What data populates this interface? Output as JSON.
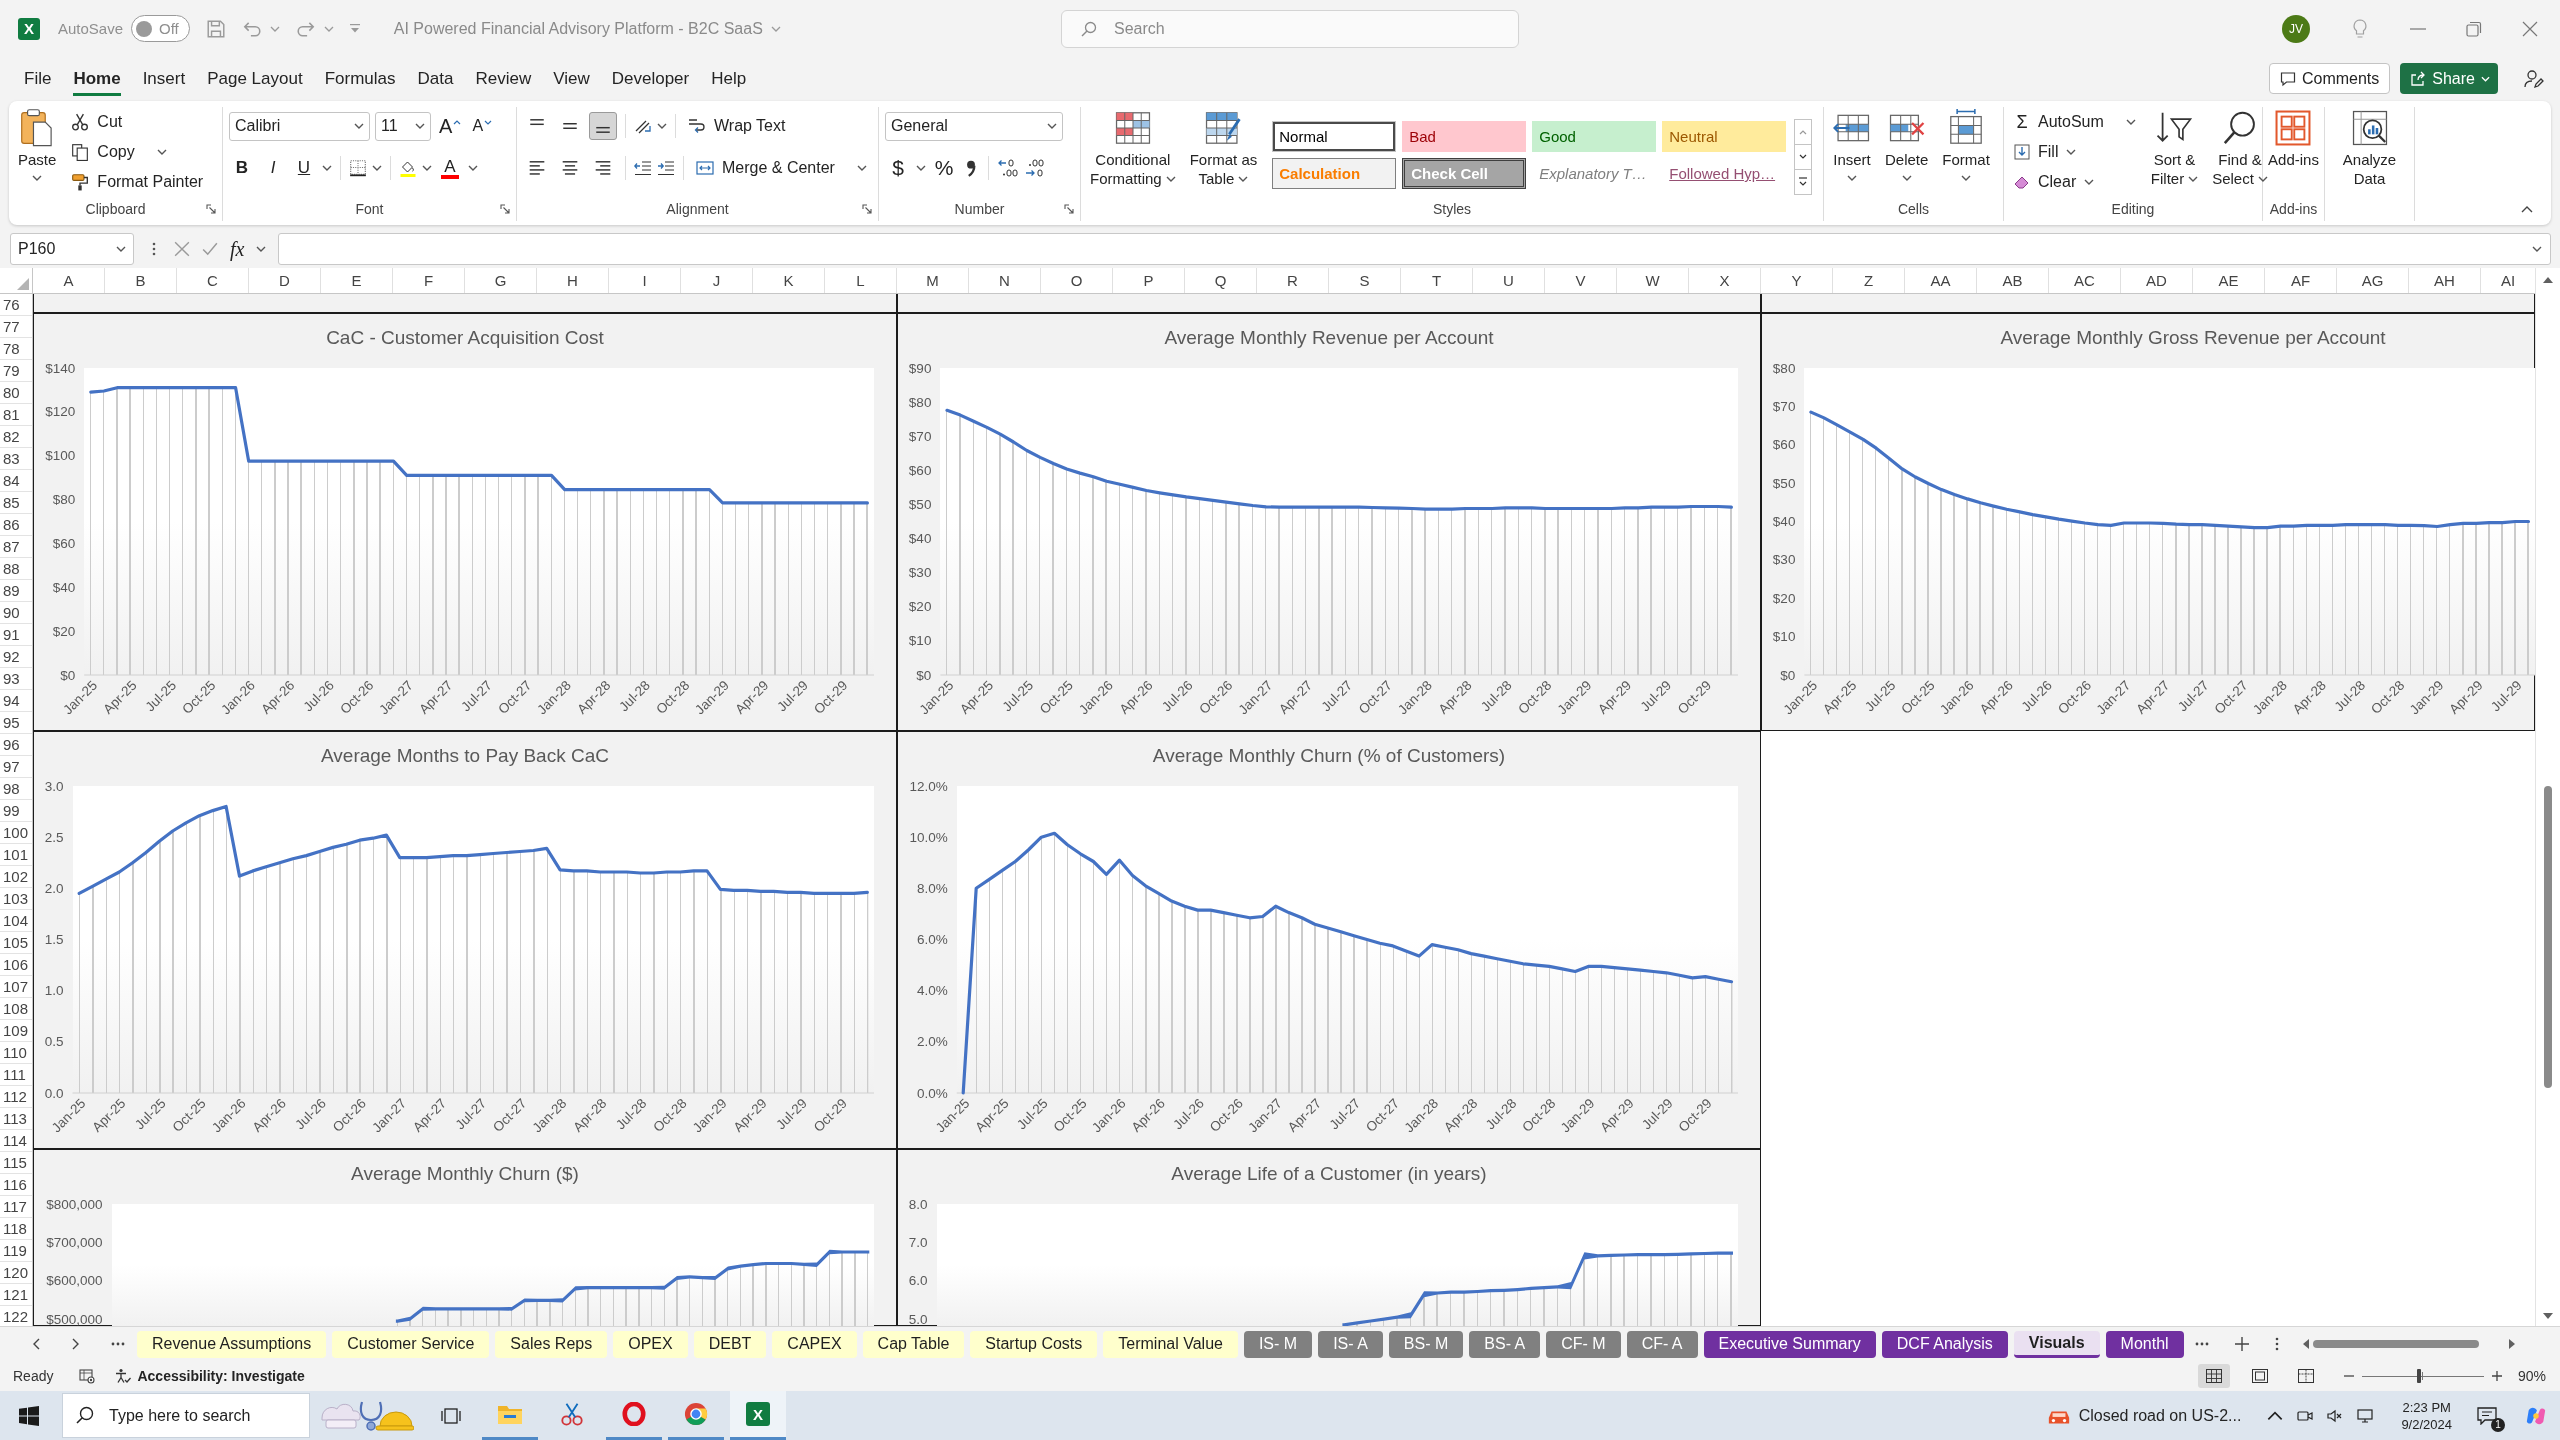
{
  "title_bar": {
    "app_icon": "X",
    "autosave": {
      "label": "AutoSave",
      "state_label": "Off",
      "on": false
    },
    "document_title": "AI Powered Financial Advisory Platform - B2C SaaS",
    "search": {
      "placeholder": "Search"
    },
    "avatar": "JV"
  },
  "menu": {
    "tabs": [
      {
        "label": "File",
        "selected": false
      },
      {
        "label": "Home",
        "selected": true
      },
      {
        "label": "Insert",
        "selected": false
      },
      {
        "label": "Page Layout",
        "selected": false
      },
      {
        "label": "Formulas",
        "selected": false
      },
      {
        "label": "Data",
        "selected": false
      },
      {
        "label": "Review",
        "selected": false
      },
      {
        "label": "View",
        "selected": false
      },
      {
        "label": "Developer",
        "selected": false
      },
      {
        "label": "Help",
        "selected": false
      }
    ],
    "comments": "Comments",
    "share": "Share"
  },
  "ribbon": {
    "clipboard": {
      "label": "Clipboard",
      "paste": "Paste",
      "cut": "Cut",
      "copy": "Copy",
      "format_painter": "Format Painter"
    },
    "font": {
      "label": "Font",
      "font_name": "Calibri",
      "font_size": "11",
      "grow": "A",
      "shrink": "A",
      "bold": "B",
      "italic": "I",
      "underline": "U",
      "font_color": "A"
    },
    "alignment": {
      "label": "Alignment",
      "vertical": [
        {
          "kind": "top",
          "selected": false
        },
        {
          "kind": "middle",
          "selected": false
        },
        {
          "kind": "bottom",
          "selected": true
        }
      ],
      "horizontal": [
        {
          "kind": "left",
          "selected": false
        },
        {
          "kind": "center",
          "selected": false
        },
        {
          "kind": "right",
          "selected": false
        }
      ],
      "wrap_text": "Wrap Text",
      "merge_center": "Merge & Center"
    },
    "number": {
      "label": "Number",
      "format": "General",
      "currency": "$",
      "percent": "%"
    },
    "styles": {
      "label": "Styles",
      "conditional_formatting": [
        "Conditional",
        "Formatting"
      ],
      "format_as_table": [
        "Format as",
        "Table"
      ],
      "gallery": [
        {
          "label": "Normal",
          "kind": "normal",
          "selected": true
        },
        {
          "label": "Bad",
          "kind": "bad",
          "selected": false
        },
        {
          "label": "Good",
          "kind": "good",
          "selected": false
        },
        {
          "label": "Neutral",
          "kind": "neutral",
          "selected": false
        },
        {
          "label": "Calculation",
          "kind": "calculation",
          "selected": false
        },
        {
          "label": "Check Cell",
          "kind": "check",
          "selected": false
        },
        {
          "label": "Explanatory T…",
          "kind": "explanatory",
          "selected": false
        },
        {
          "label": "Followed Hyp…",
          "kind": "followed_link",
          "selected": false
        }
      ]
    },
    "cells": {
      "label": "Cells",
      "buttons": [
        {
          "kind": "insert",
          "label": "Insert"
        },
        {
          "kind": "delete",
          "label": "Delete"
        },
        {
          "kind": "format",
          "label": "Format"
        }
      ]
    },
    "editing": {
      "label": "Editing",
      "autosum_symbol": "Σ",
      "autosum": "AutoSum",
      "fill": "Fill",
      "clear": "Clear",
      "sort_filter": [
        "Sort &",
        "Filter"
      ],
      "find_select": [
        "Find &",
        "Select"
      ]
    },
    "add_ins": {
      "label": "Add-ins",
      "button": "Add-ins"
    },
    "analyze": {
      "button": [
        "Analyze",
        "Data"
      ]
    }
  },
  "formula_bar": {
    "name_box": "P160",
    "fx": "fx"
  },
  "sheet": {
    "columns": [
      "A",
      "B",
      "C",
      "D",
      "E",
      "F",
      "G",
      "H",
      "I",
      "J",
      "K",
      "L",
      "M",
      "N",
      "O",
      "P",
      "Q",
      "R",
      "S",
      "T",
      "U",
      "V",
      "W",
      "X",
      "Y",
      "Z",
      "AA",
      "AB",
      "AC",
      "AD",
      "AE",
      "AF",
      "AG",
      "AH",
      "AI"
    ],
    "rows": [
      "76",
      "77",
      "78",
      "79",
      "80",
      "81",
      "82",
      "83",
      "84",
      "85",
      "86",
      "87",
      "88",
      "89",
      "90",
      "91",
      "92",
      "93",
      "94",
      "95",
      "96",
      "97",
      "98",
      "99",
      "100",
      "101",
      "102",
      "103",
      "104",
      "105",
      "106",
      "107",
      "108",
      "109",
      "110",
      "111",
      "112",
      "113",
      "114",
      "115",
      "116",
      "117",
      "118",
      "119",
      "120",
      "121",
      "122"
    ],
    "chart_rows": [
      [
        {
          "kind": "data_chart",
          "chart_data": {
            "type": "line",
            "title": "CaC - Customer Acquisition Cost",
            "ylim": [
              0,
              140
            ],
            "yticks": [
              {
                "value": 0,
                "label": "$0"
              },
              {
                "value": 20,
                "label": "$20"
              },
              {
                "value": 40,
                "label": "$40"
              },
              {
                "value": 60,
                "label": "$60"
              },
              {
                "value": 80,
                "label": "$80"
              },
              {
                "value": 100,
                "label": "$100"
              },
              {
                "value": 120,
                "label": "$120"
              },
              {
                "value": 140,
                "label": "$140"
              }
            ],
            "categories": [
              "Jan-25",
              null,
              null,
              "Apr-25",
              null,
              null,
              "Jul-25",
              null,
              null,
              "Oct-25",
              null,
              null,
              "Jan-26",
              null,
              null,
              "Apr-26",
              null,
              null,
              "Jul-26",
              null,
              null,
              "Oct-26",
              null,
              null,
              "Jan-27",
              null,
              null,
              "Apr-27",
              null,
              null,
              "Jul-27",
              null,
              null,
              "Oct-27",
              null,
              null,
              "Jan-28",
              null,
              null,
              "Apr-28",
              null,
              null,
              "Jul-28",
              null,
              null,
              "Oct-28",
              null,
              null,
              "Jan-29",
              null,
              null,
              "Apr-29",
              null,
              null,
              "Jul-29",
              null,
              null,
              "Oct-29",
              null,
              null
            ],
            "values": [
              129,
              129.5,
              131,
              131,
              131,
              131,
              131,
              131,
              131,
              131,
              131,
              131,
              97.5,
              97.5,
              97.5,
              97.5,
              97.5,
              97.5,
              97.5,
              97.5,
              97.5,
              97.5,
              97.5,
              97.5,
              91,
              91,
              91,
              91,
              91,
              91,
              91,
              91,
              91,
              91,
              91,
              91,
              84.5,
              84.5,
              84.5,
              84.5,
              84.5,
              84.5,
              84.5,
              84.5,
              84.5,
              84.5,
              84.5,
              84.5,
              78.5,
              78.5,
              78.5,
              78.5,
              78.5,
              78.5,
              78.5,
              78.5,
              78.5,
              78.5,
              78.5,
              78.5
            ]
          }
        },
        {
          "kind": "data_chart",
          "chart_data": {
            "type": "line",
            "title": "Average Monthly Revenue per Account",
            "ylim": [
              0,
              90
            ],
            "yticks": [
              {
                "value": 0,
                "label": "$0"
              },
              {
                "value": 10,
                "label": "$10"
              },
              {
                "value": 20,
                "label": "$20"
              },
              {
                "value": 30,
                "label": "$30"
              },
              {
                "value": 40,
                "label": "$40"
              },
              {
                "value": 50,
                "label": "$50"
              },
              {
                "value": 60,
                "label": "$60"
              },
              {
                "value": 70,
                "label": "$70"
              },
              {
                "value": 80,
                "label": "$80"
              },
              {
                "value": 90,
                "label": "$90"
              }
            ],
            "categories": [
              "Jan-25",
              null,
              null,
              "Apr-25",
              null,
              null,
              "Jul-25",
              null,
              null,
              "Oct-25",
              null,
              null,
              "Jan-26",
              null,
              null,
              "Apr-26",
              null,
              null,
              "Jul-26",
              null,
              null,
              "Oct-26",
              null,
              null,
              "Jan-27",
              null,
              null,
              "Apr-27",
              null,
              null,
              "Jul-27",
              null,
              null,
              "Oct-27",
              null,
              null,
              "Jan-28",
              null,
              null,
              "Apr-28",
              null,
              null,
              "Jul-28",
              null,
              null,
              "Oct-28",
              null,
              null,
              "Jan-29",
              null,
              null,
              "Apr-29",
              null,
              null,
              "Jul-29",
              null,
              null,
              "Oct-29",
              null,
              null
            ],
            "values": [
              77.6,
              76.2,
              74.4,
              72.6,
              70.6,
              68.3,
              65.8,
              63.8,
              62.0,
              60.4,
              59.2,
              58.1,
              56.8,
              55.9,
              55.0,
              54.1,
              53.4,
              52.8,
              52.2,
              51.7,
              51.2,
              50.7,
              50.2,
              49.7,
              49.3,
              49.2,
              49.2,
              49.2,
              49.2,
              49.2,
              49.2,
              49.2,
              49.1,
              49.0,
              48.9,
              48.8,
              48.6,
              48.6,
              48.6,
              48.8,
              48.8,
              48.8,
              49.0,
              49.0,
              49.0,
              48.8,
              48.8,
              48.8,
              48.8,
              48.8,
              48.8,
              49.0,
              49.0,
              49.2,
              49.2,
              49.2,
              49.4,
              49.4,
              49.4,
              49.2
            ]
          }
        },
        {
          "kind": "data_chart",
          "chart_data": {
            "type": "line",
            "title": "Average Monthly Gross Revenue per Account",
            "ylim": [
              0,
              80
            ],
            "yticks": [
              {
                "value": 0,
                "label": "$0"
              },
              {
                "value": 10,
                "label": "$10"
              },
              {
                "value": 20,
                "label": "$20"
              },
              {
                "value": 30,
                "label": "$30"
              },
              {
                "value": 40,
                "label": "$40"
              },
              {
                "value": 50,
                "label": "$50"
              },
              {
                "value": 60,
                "label": "$60"
              },
              {
                "value": 70,
                "label": "$70"
              },
              {
                "value": 80,
                "label": "$80"
              }
            ],
            "categories": [
              "Jan-25",
              null,
              null,
              "Apr-25",
              null,
              null,
              "Jul-25",
              null,
              null,
              "Oct-25",
              null,
              null,
              "Jan-26",
              null,
              null,
              "Apr-26",
              null,
              null,
              "Jul-26",
              null,
              null,
              "Oct-26",
              null,
              null,
              "Jan-27",
              null,
              null,
              "Apr-27",
              null,
              null,
              "Jul-27",
              null,
              null,
              "Oct-27",
              null,
              null,
              "Jan-28",
              null,
              null,
              "Apr-28",
              null,
              null,
              "Jul-28",
              null,
              null,
              "Oct-28",
              null,
              null,
              "Jan-29",
              null,
              null,
              "Apr-29",
              null,
              null,
              "Jul-29",
              null
            ],
            "values": [
              68.5,
              67.0,
              65.2,
              63.3,
              61.4,
              59.1,
              56.4,
              53.7,
              51.6,
              49.9,
              48.3,
              47.0,
              45.9,
              44.9,
              44.0,
              43.2,
              42.5,
              41.8,
              41.2,
              40.6,
              40.1,
              39.6,
              39.2,
              39.0,
              39.6,
              39.6,
              39.6,
              39.5,
              39.3,
              39.2,
              39.2,
              39.0,
              38.8,
              38.6,
              38.4,
              38.4,
              38.8,
              38.8,
              39.0,
              39.0,
              39.0,
              39.2,
              39.2,
              39.2,
              39.2,
              39.0,
              39.0,
              38.9,
              38.7,
              39.2,
              39.5,
              39.5,
              39.7,
              39.7,
              40.0,
              40.0
            ]
          }
        }
      ],
      [
        {
          "kind": "data_chart",
          "chart_data": {
            "type": "line",
            "title": "Average Months to Pay Back CaC",
            "ylim": [
              0,
              3
            ],
            "yticks": [
              {
                "value": 0,
                "label": "0.0"
              },
              {
                "value": 0.5,
                "label": "0.5"
              },
              {
                "value": 1,
                "label": "1.0"
              },
              {
                "value": 1.5,
                "label": "1.5"
              },
              {
                "value": 2,
                "label": "2.0"
              },
              {
                "value": 2.5,
                "label": "2.5"
              },
              {
                "value": 3,
                "label": "3.0"
              }
            ],
            "categories": [
              "Jan-25",
              null,
              null,
              "Apr-25",
              null,
              null,
              "Jul-25",
              null,
              null,
              "Oct-25",
              null,
              null,
              "Jan-26",
              null,
              null,
              "Apr-26",
              null,
              null,
              "Jul-26",
              null,
              null,
              "Oct-26",
              null,
              null,
              "Jan-27",
              null,
              null,
              "Apr-27",
              null,
              null,
              "Jul-27",
              null,
              null,
              "Oct-27",
              null,
              null,
              "Jan-28",
              null,
              null,
              "Apr-28",
              null,
              null,
              "Jul-28",
              null,
              null,
              "Oct-28",
              null,
              null,
              "Jan-29",
              null,
              null,
              "Apr-29",
              null,
              null,
              "Jul-29",
              null,
              null,
              "Oct-29",
              null,
              null
            ],
            "values": [
              1.95,
              2.02,
              2.09,
              2.16,
              2.25,
              2.35,
              2.46,
              2.56,
              2.64,
              2.71,
              2.76,
              2.8,
              2.12,
              2.17,
              2.21,
              2.25,
              2.29,
              2.32,
              2.36,
              2.4,
              2.43,
              2.47,
              2.49,
              2.52,
              2.3,
              2.3,
              2.3,
              2.31,
              2.32,
              2.32,
              2.33,
              2.34,
              2.35,
              2.36,
              2.37,
              2.39,
              2.18,
              2.17,
              2.17,
              2.16,
              2.16,
              2.16,
              2.15,
              2.15,
              2.16,
              2.16,
              2.17,
              2.17,
              1.99,
              1.98,
              1.98,
              1.97,
              1.97,
              1.96,
              1.96,
              1.95,
              1.95,
              1.95,
              1.95,
              1.96
            ]
          }
        },
        {
          "kind": "data_chart",
          "chart_data": {
            "type": "line",
            "title": "Average Monthly Churn (% of Customers)",
            "ylim": [
              0,
              12
            ],
            "yticks": [
              {
                "value": 0,
                "label": "0.0%"
              },
              {
                "value": 2,
                "label": "2.0%"
              },
              {
                "value": 4,
                "label": "4.0%"
              },
              {
                "value": 6,
                "label": "6.0%"
              },
              {
                "value": 8,
                "label": "8.0%"
              },
              {
                "value": 10,
                "label": "10.0%"
              },
              {
                "value": 12,
                "label": "12.0%"
              }
            ],
            "categories": [
              "Jan-25",
              null,
              null,
              "Apr-25",
              null,
              null,
              "Jul-25",
              null,
              null,
              "Oct-25",
              null,
              null,
              "Jan-26",
              null,
              null,
              "Apr-26",
              null,
              null,
              "Jul-26",
              null,
              null,
              "Oct-26",
              null,
              null,
              "Jan-27",
              null,
              null,
              "Apr-27",
              null,
              null,
              "Jul-27",
              null,
              null,
              "Oct-27",
              null,
              null,
              "Jan-28",
              null,
              null,
              "Apr-28",
              null,
              null,
              "Jul-28",
              null,
              null,
              "Oct-28",
              null,
              null,
              "Jan-29",
              null,
              null,
              "Apr-29",
              null,
              null,
              "Jul-29",
              null,
              null,
              "Oct-29",
              null,
              null
            ],
            "values": [
              0,
              8.0,
              8.35,
              8.7,
              9.05,
              9.5,
              10.0,
              10.15,
              9.7,
              9.35,
              9.05,
              8.55,
              9.1,
              8.5,
              8.1,
              7.8,
              7.5,
              7.3,
              7.15,
              7.15,
              7.05,
              6.95,
              6.85,
              6.9,
              7.3,
              7.05,
              6.85,
              6.6,
              6.45,
              6.3,
              6.15,
              6.0,
              5.85,
              5.75,
              5.55,
              5.35,
              5.8,
              5.7,
              5.6,
              5.45,
              5.35,
              5.25,
              5.15,
              5.05,
              5.0,
              4.95,
              4.85,
              4.75,
              4.95,
              4.95,
              4.9,
              4.85,
              4.8,
              4.75,
              4.7,
              4.6,
              4.5,
              4.55,
              4.45,
              4.35
            ]
          }
        }
      ],
      [
        {
          "kind": "picture",
          "title": "Average Monthly Churn ($)",
          "y_tick_labels": [
            "$800,000",
            "$700,000",
            "$600,000",
            "$500,000"
          ]
        },
        {
          "kind": "picture",
          "title": "Average Life of a Customer (in years)",
          "y_tick_labels": [
            "8.0",
            "7.0",
            "6.0",
            "5.0"
          ]
        }
      ]
    ]
  },
  "sheet_tabs": [
    {
      "label": "Revenue Assumptions",
      "color": "#ffffcc",
      "selected": false
    },
    {
      "label": "Customer Service",
      "color": "#ffffcc",
      "selected": false
    },
    {
      "label": "Sales Reps",
      "color": "#ffffcc",
      "selected": false
    },
    {
      "label": "OPEX",
      "color": "#ffffcc",
      "selected": false
    },
    {
      "label": "DEBT",
      "color": "#ffffcc",
      "selected": false
    },
    {
      "label": "CAPEX",
      "color": "#ffffcc",
      "selected": false
    },
    {
      "label": "Cap Table",
      "color": "#ffffcc",
      "selected": false
    },
    {
      "label": "Startup Costs",
      "color": "#ffffcc",
      "selected": false
    },
    {
      "label": "Terminal Value",
      "color": "#ffffcc",
      "selected": false
    },
    {
      "label": "IS- M",
      "color": "#808080",
      "selected": false
    },
    {
      "label": "IS- A",
      "color": "#808080",
      "selected": false
    },
    {
      "label": "BS- M",
      "color": "#808080",
      "selected": false
    },
    {
      "label": "BS- A",
      "color": "#808080",
      "selected": false
    },
    {
      "label": "CF- M",
      "color": "#808080",
      "selected": false
    },
    {
      "label": "CF- A",
      "color": "#808080",
      "selected": false
    },
    {
      "label": "Executive Summary",
      "color": "#7030a0",
      "selected": false
    },
    {
      "label": "DCF Analysis",
      "color": "#7030a0",
      "selected": false
    },
    {
      "label": "Visuals",
      "color": "#7030a0",
      "selected": true
    },
    {
      "label": "Monthl",
      "color": "#7030a0",
      "selected": false
    }
  ],
  "status_bar": {
    "status": "Ready",
    "accessibility": "Accessibility: Investigate",
    "views": [
      {
        "kind": "normal",
        "selected": true
      },
      {
        "kind": "page_layout",
        "selected": false
      },
      {
        "kind": "page_break",
        "selected": false
      }
    ],
    "zoom": {
      "level": 0.47,
      "reading": "90%"
    }
  },
  "taskbar": {
    "search_placeholder": "Type here to search",
    "apps": [
      {
        "kind": "explorer",
        "running": true,
        "selected": false
      },
      {
        "kind": "snipping",
        "running": false,
        "selected": false
      },
      {
        "kind": "opera",
        "running": true,
        "selected": false
      },
      {
        "kind": "chrome",
        "running": true,
        "selected": false
      },
      {
        "kind": "excel",
        "letter": "X",
        "running": true,
        "selected": true
      }
    ],
    "news": "Closed road on US-2...",
    "time": "2:23 PM",
    "date": "9/2/2024",
    "notifications": "1"
  }
}
